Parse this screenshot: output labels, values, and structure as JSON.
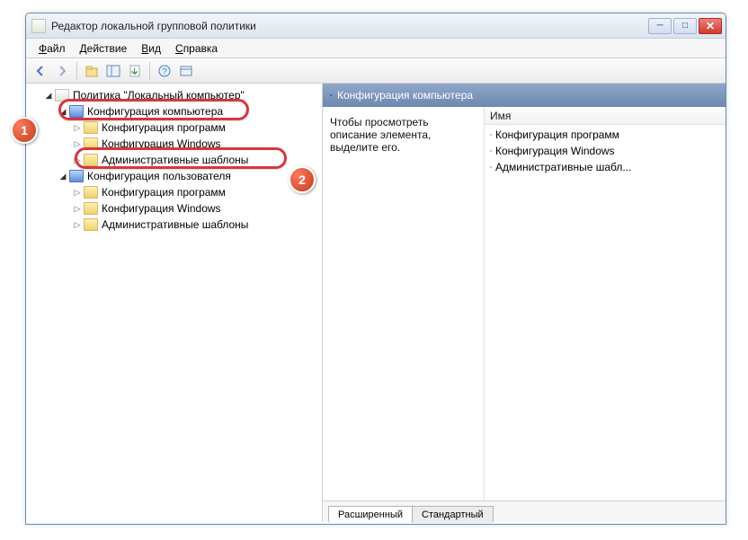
{
  "window": {
    "title": "Редактор локальной групповой политики"
  },
  "menu": {
    "file": "Файл",
    "action": "Действие",
    "view": "Вид",
    "help": "Справка"
  },
  "tree": {
    "root": "Политика \"Локальный компьютер\"",
    "computer_config": "Конфигурация компьютера",
    "software_settings": "Конфигурация программ",
    "windows_settings": "Конфигурация Windows",
    "admin_templates": "Административные шаблоны",
    "user_config": "Конфигурация пользователя"
  },
  "right": {
    "header": "Конфигурация компьютера",
    "description": "Чтобы просмотреть описание элемента, выделите его.",
    "column_name": "Имя",
    "items": [
      "Конфигурация программ",
      "Конфигурация Windows",
      "Административные шабл..."
    ]
  },
  "tabs": {
    "extended": "Расширенный",
    "standard": "Стандартный"
  },
  "callouts": {
    "one": "1",
    "two": "2"
  }
}
